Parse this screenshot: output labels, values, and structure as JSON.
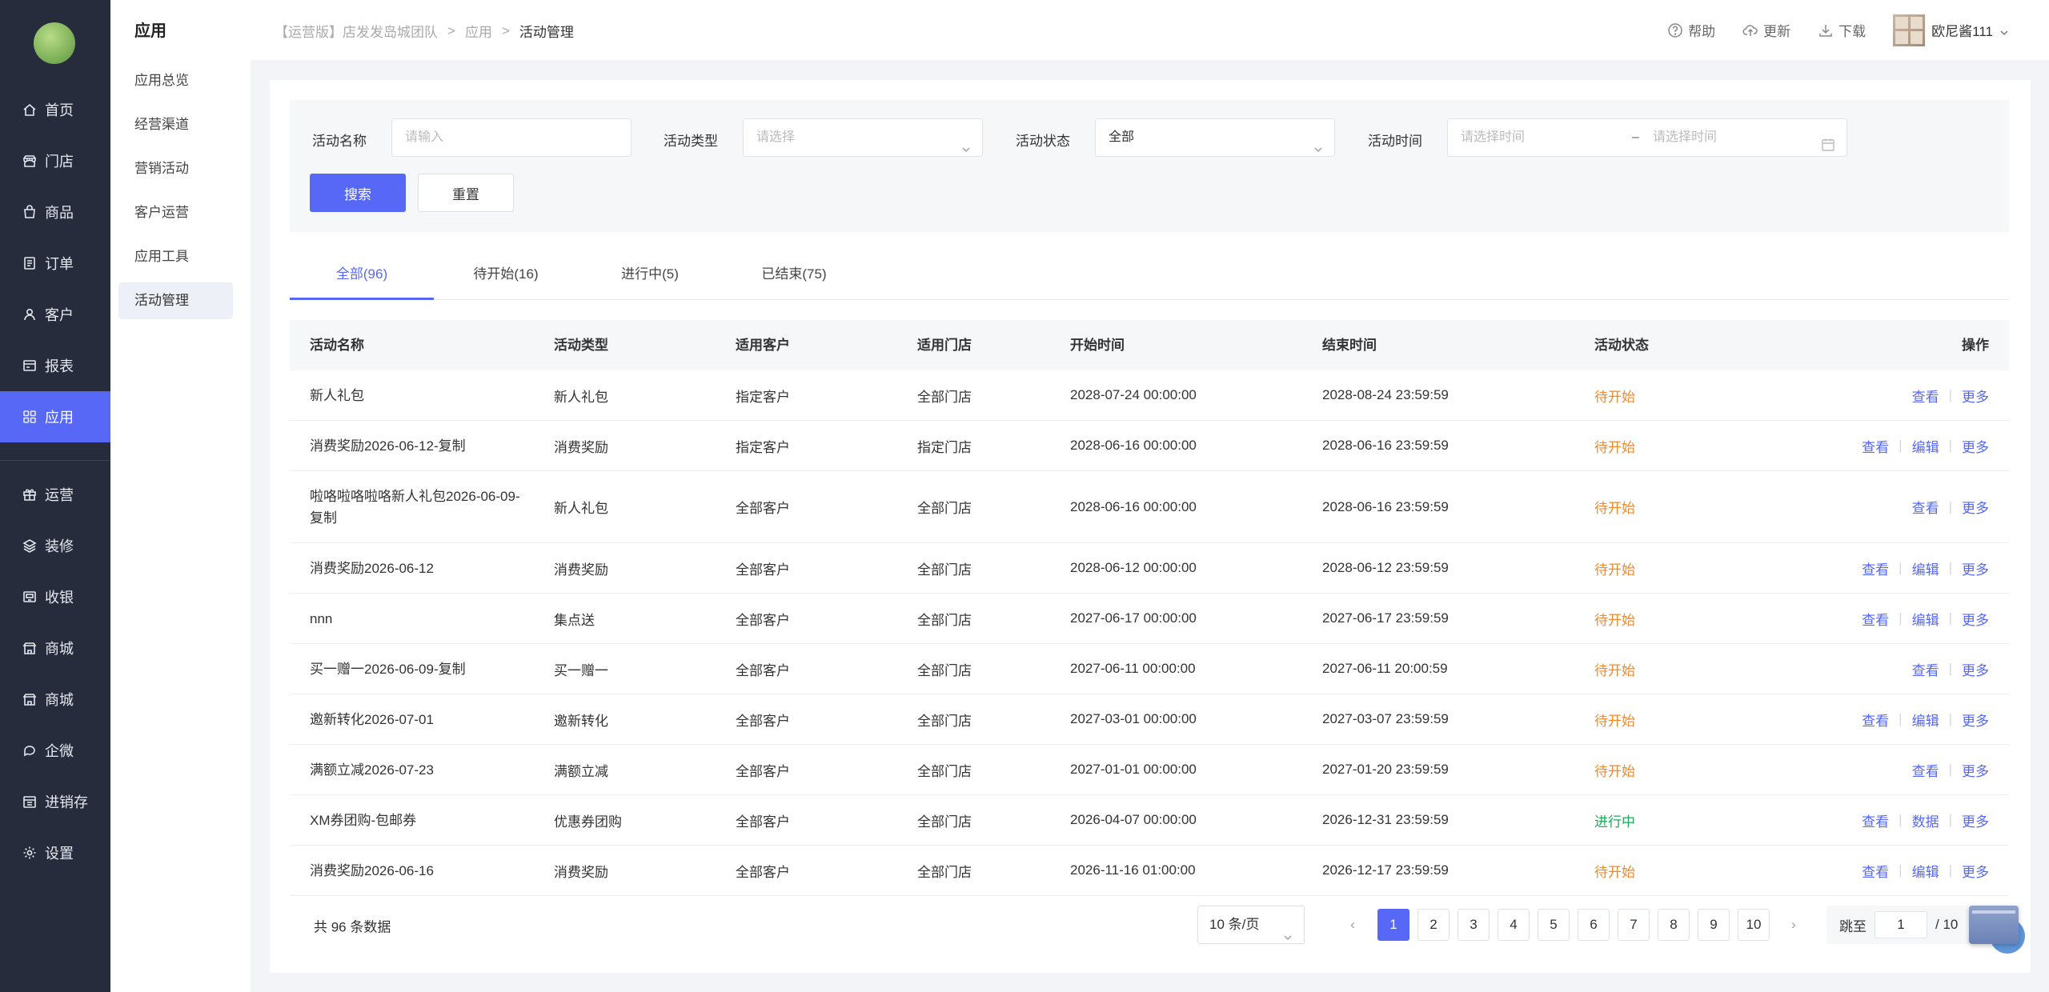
{
  "rail": {
    "items": [
      {
        "label": "首页",
        "icon": "home-icon"
      },
      {
        "label": "门店",
        "icon": "store-icon"
      },
      {
        "label": "商品",
        "icon": "bag-icon"
      },
      {
        "label": "订单",
        "icon": "order-icon"
      },
      {
        "label": "客户",
        "icon": "user-icon"
      },
      {
        "label": "报表",
        "icon": "report-icon"
      },
      {
        "label": "应用",
        "icon": "grid-icon",
        "active": true
      },
      {
        "label": "运营",
        "icon": "gift-icon"
      },
      {
        "label": "装修",
        "icon": "layers-icon"
      },
      {
        "label": "收银",
        "icon": "cashier-icon"
      },
      {
        "label": "商城",
        "icon": "mall-icon"
      },
      {
        "label": "商城",
        "icon": "mall-icon"
      },
      {
        "label": "企微",
        "icon": "chat-icon"
      },
      {
        "label": "进销存",
        "icon": "inventory-icon"
      },
      {
        "label": "设置",
        "icon": "gear-icon"
      }
    ]
  },
  "sub": {
    "title": "应用",
    "items": [
      "应用总览",
      "经营渠道",
      "营销活动",
      "客户运营",
      "应用工具",
      "活动管理"
    ]
  },
  "topbar": {
    "crumbs": [
      "【运营版】店发发岛城团队",
      "应用",
      "活动管理"
    ],
    "help": "帮助",
    "update": "更新",
    "download": "下载",
    "user": "欧尼酱111"
  },
  "filter": {
    "name_label": "活动名称",
    "name_placeholder": "请输入",
    "type_label": "活动类型",
    "type_placeholder": "请选择",
    "status_label": "活动状态",
    "status_value": "全部",
    "time_label": "活动时间",
    "time_start_placeholder": "请选择时间",
    "time_dash": "–",
    "time_end_placeholder": "请选择时间",
    "search": "搜索",
    "reset": "重置"
  },
  "tabs": [
    "全部(96)",
    "待开始(16)",
    "进行中(5)",
    "已结束(75)"
  ],
  "table": {
    "headers": [
      "活动名称",
      "活动类型",
      "适用客户",
      "适用门店",
      "开始时间",
      "结束时间",
      "活动状态",
      "操作"
    ],
    "rows": [
      {
        "name": "新人礼包",
        "type": "新人礼包",
        "customer": "指定客户",
        "store": "全部门店",
        "start": "2028-07-24 00:00:00",
        "end": "2028-08-24 23:59:59",
        "status": "待开始",
        "ops": [
          "查看",
          "更多"
        ]
      },
      {
        "name": "消费奖励2026-06-12-复制",
        "type": "消费奖励",
        "customer": "指定客户",
        "store": "指定门店",
        "start": "2028-06-16 00:00:00",
        "end": "2028-06-16 23:59:59",
        "status": "待开始",
        "ops": [
          "查看",
          "编辑",
          "更多"
        ]
      },
      {
        "name": "啦咯啦咯啦咯新人礼包2026-06-09-复制",
        "type": "新人礼包",
        "customer": "全部客户",
        "store": "全部门店",
        "start": "2028-06-16 00:00:00",
        "end": "2028-06-16 23:59:59",
        "status": "待开始",
        "ops": [
          "查看",
          "更多"
        ]
      },
      {
        "name": "消费奖励2026-06-12",
        "type": "消费奖励",
        "customer": "全部客户",
        "store": "全部门店",
        "start": "2028-06-12 00:00:00",
        "end": "2028-06-12 23:59:59",
        "status": "待开始",
        "ops": [
          "查看",
          "编辑",
          "更多"
        ]
      },
      {
        "name": "nnn",
        "type": "集点送",
        "customer": "全部客户",
        "store": "全部门店",
        "start": "2027-06-17 00:00:00",
        "end": "2027-06-17 23:59:59",
        "status": "待开始",
        "ops": [
          "查看",
          "编辑",
          "更多"
        ]
      },
      {
        "name": "买一赠一2026-06-09-复制",
        "type": "买一赠一",
        "customer": "全部客户",
        "store": "全部门店",
        "start": "2027-06-11 00:00:00",
        "end": "2027-06-11 20:00:59",
        "status": "待开始",
        "ops": [
          "查看",
          "更多"
        ]
      },
      {
        "name": "邀新转化2026-07-01",
        "type": "邀新转化",
        "customer": "全部客户",
        "store": "全部门店",
        "start": "2027-03-01 00:00:00",
        "end": "2027-03-07 23:59:59",
        "status": "待开始",
        "ops": [
          "查看",
          "编辑",
          "更多"
        ]
      },
      {
        "name": "满额立减2026-07-23",
        "type": "满额立减",
        "customer": "全部客户",
        "store": "全部门店",
        "start": "2027-01-01 00:00:00",
        "end": "2027-01-20 23:59:59",
        "status": "待开始",
        "ops": [
          "查看",
          "更多"
        ]
      },
      {
        "name": "XM券团购-包邮券",
        "type": "优惠券团购",
        "customer": "全部客户",
        "store": "全部门店",
        "start": "2026-04-07 00:00:00",
        "end": "2026-12-31 23:59:59",
        "status": "进行中",
        "ops": [
          "查看",
          "数据",
          "更多"
        ]
      },
      {
        "name": "消费奖励2026-06-16",
        "type": "消费奖励",
        "customer": "全部客户",
        "store": "全部门店",
        "start": "2026-11-16 01:00:00",
        "end": "2026-12-17 23:59:59",
        "status": "待开始",
        "ops": [
          "查看",
          "编辑",
          "更多"
        ]
      }
    ]
  },
  "pagination": {
    "total_text": "共 96 条数据",
    "page_size": "10 条/页",
    "pages": [
      "1",
      "2",
      "3",
      "4",
      "5",
      "6",
      "7",
      "8",
      "9",
      "10"
    ],
    "current": "1",
    "jump_label": "跳至",
    "jump_value": "1",
    "jump_total": "/ 10"
  },
  "colors": {
    "accent": "#5668f5",
    "rail": "#272c3d",
    "wait": "#f08a2c",
    "running": "#1ea85a"
  }
}
